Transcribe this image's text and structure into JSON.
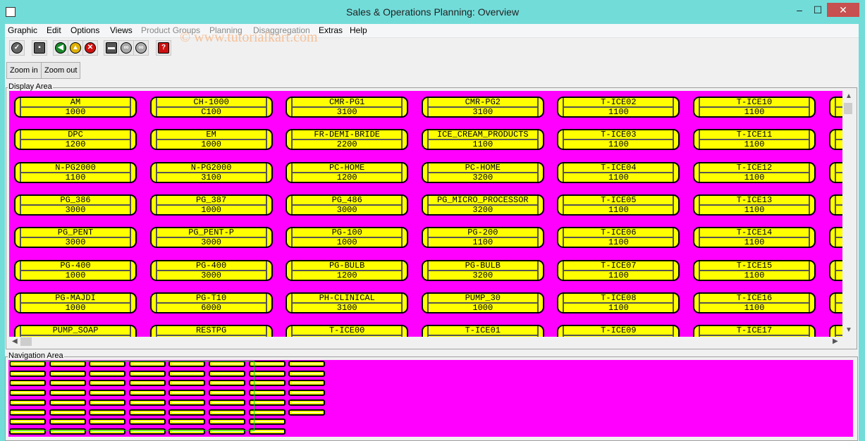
{
  "window": {
    "title": "Sales & Operations Planning: Overview",
    "minimize": "‒",
    "maximize": "☐",
    "close": "✕"
  },
  "menu": [
    {
      "label": "Graphic",
      "enabled": true
    },
    {
      "label": "Edit",
      "enabled": true
    },
    {
      "label": "Options",
      "enabled": true
    },
    {
      "label": "Views",
      "enabled": true
    },
    {
      "label": "Product Groups",
      "enabled": false
    },
    {
      "label": "Planning",
      "enabled": false
    },
    {
      "label": "Disaggregation",
      "enabled": false
    },
    {
      "label": "Extras",
      "enabled": true
    },
    {
      "label": "Help",
      "enabled": true
    }
  ],
  "watermark": "© www.tutorialkart.com",
  "toolbar": [
    {
      "icon": "check-icon",
      "glyph": "✓",
      "color": "#666666"
    },
    {
      "icon": "save-icon",
      "glyph": "▪",
      "color": "#555555"
    },
    {
      "icon": "back-icon",
      "glyph": "◀",
      "color": "#1a8a2a"
    },
    {
      "icon": "exit-icon",
      "glyph": "▲",
      "color": "#e0b000"
    },
    {
      "icon": "cancel-icon",
      "glyph": "✕",
      "color": "#d01010"
    },
    {
      "icon": "print-icon",
      "glyph": "▬",
      "color": "#555555"
    },
    {
      "icon": "find-icon",
      "glyph": "∞",
      "color": "#aaaaaa"
    },
    {
      "icon": "find-next-icon",
      "glyph": "∞",
      "color": "#aaaaaa"
    },
    {
      "icon": "help-icon",
      "glyph": "?",
      "color": "#cc1111"
    }
  ],
  "zoom": {
    "in": "Zoom in",
    "out": "Zoom out"
  },
  "display_area": {
    "label": "Display Area",
    "columns": [
      [
        [
          "AM",
          "1000"
        ],
        [
          "DPC",
          "1200"
        ],
        [
          "N-PG2000",
          "1100"
        ],
        [
          "PG_386",
          "3000"
        ],
        [
          "PG_PENT",
          "3000"
        ],
        [
          "PG-400",
          "1000"
        ],
        [
          "PG-MAJDI",
          "1000"
        ],
        [
          "PUMP_SOAP",
          ""
        ]
      ],
      [
        [
          "CH-1000",
          "C100"
        ],
        [
          "EM",
          "1000"
        ],
        [
          "N-PG2000",
          "3100"
        ],
        [
          "PG_387",
          "1000"
        ],
        [
          "PG_PENT-P",
          "3000"
        ],
        [
          "PG-400",
          "3000"
        ],
        [
          "PG-T10",
          "6000"
        ],
        [
          "RESTPG",
          ""
        ]
      ],
      [
        [
          "CMR-PG1",
          "3100"
        ],
        [
          "FR-DEMI-BRIDE",
          "2200"
        ],
        [
          "PC-HOME",
          "1200"
        ],
        [
          "PG_486",
          "3000"
        ],
        [
          "PG-100",
          "1000"
        ],
        [
          "PG-BULB",
          "1200"
        ],
        [
          "PH-CLINICAL",
          "3100"
        ],
        [
          "T-ICE00",
          ""
        ]
      ],
      [
        [
          "CMR-PG2",
          "3100"
        ],
        [
          "ICE_CREAM_PRODUCTS",
          "1100"
        ],
        [
          "PC-HOME",
          "3200"
        ],
        [
          "PG_MICRO_PROCESSOR",
          "3200"
        ],
        [
          "PG-200",
          "1100"
        ],
        [
          "PG-BULB",
          "3200"
        ],
        [
          "PUMP_30",
          "1000"
        ],
        [
          "T-ICE01",
          ""
        ]
      ],
      [
        [
          "T-ICE02",
          "1100"
        ],
        [
          "T-ICE03",
          "1100"
        ],
        [
          "T-ICE04",
          "1100"
        ],
        [
          "T-ICE05",
          "1100"
        ],
        [
          "T-ICE06",
          "1100"
        ],
        [
          "T-ICE07",
          "1100"
        ],
        [
          "T-ICE08",
          "1100"
        ],
        [
          "T-ICE09",
          ""
        ]
      ],
      [
        [
          "T-ICE10",
          "1100"
        ],
        [
          "T-ICE11",
          "1100"
        ],
        [
          "T-ICE12",
          "1100"
        ],
        [
          "T-ICE13",
          "1100"
        ],
        [
          "T-ICE14",
          "1100"
        ],
        [
          "T-ICE15",
          "1100"
        ],
        [
          "T-ICE16",
          "1100"
        ],
        [
          "T-ICE17",
          ""
        ]
      ],
      [
        [
          "",
          ""
        ],
        [
          "",
          ""
        ],
        [
          "",
          ""
        ],
        [
          "",
          ""
        ],
        [
          "",
          ""
        ],
        [
          "",
          ""
        ],
        [
          "",
          ""
        ],
        [
          "",
          ""
        ]
      ]
    ]
  },
  "navigation_area": {
    "label": "Navigation Area",
    "column_counts": [
      8,
      8,
      8,
      8,
      8,
      8,
      8,
      6
    ]
  },
  "colors": {
    "background": "#ff00ff",
    "tile": "#ffff00",
    "viewport": "#00dd00",
    "frame": "#72dcd9",
    "close": "#c75050"
  }
}
